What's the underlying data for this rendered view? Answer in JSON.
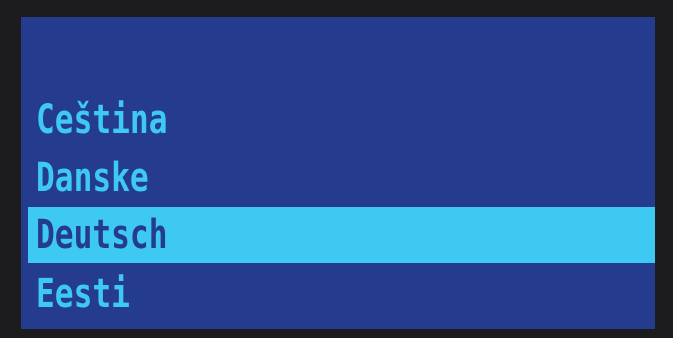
{
  "language_menu": {
    "items": [
      {
        "label": "Ceština",
        "selected": false
      },
      {
        "label": "Danske",
        "selected": false
      },
      {
        "label": "Deutsch",
        "selected": true
      },
      {
        "label": "Eesti",
        "selected": false
      }
    ]
  },
  "colors": {
    "screen_background": "#243b8e",
    "text": "#3ec9f2",
    "highlight": "#3ec9f2",
    "highlight_text": "#243b8e",
    "bezel": "#1c1c1e"
  }
}
